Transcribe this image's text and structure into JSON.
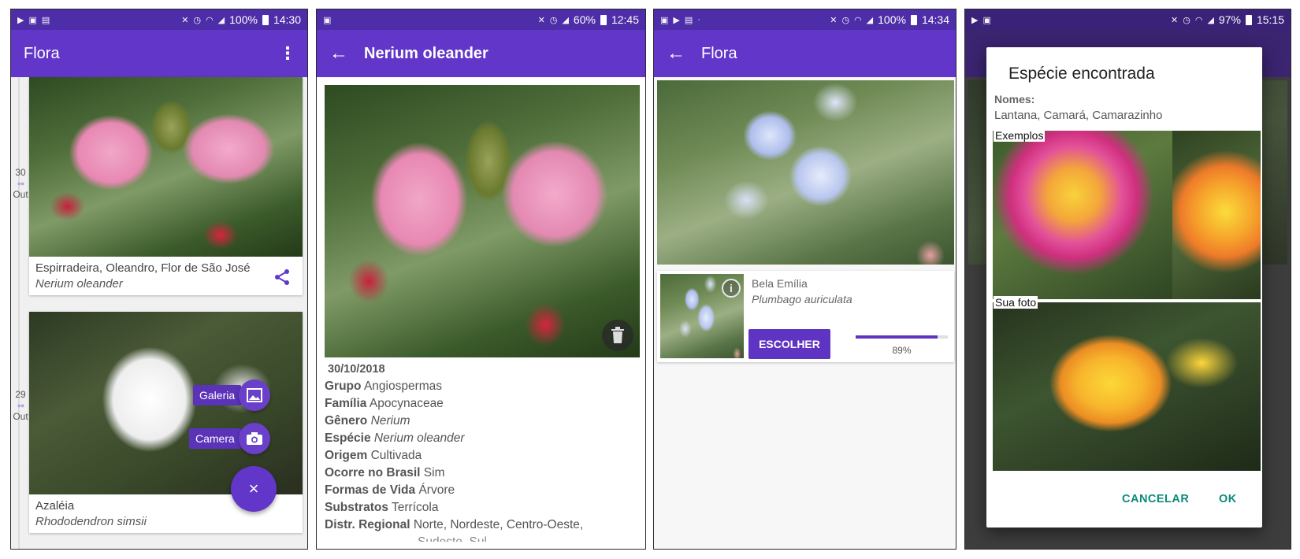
{
  "screens": [
    {
      "status": {
        "battery": "100%",
        "time": "14:30"
      },
      "appbar": {
        "title": "Flora"
      },
      "timeline": [
        {
          "day": "30",
          "month": "Out"
        },
        {
          "day": "29",
          "month": "Out"
        }
      ],
      "cards": [
        {
          "common": "Espirradeira, Oleandro, Flor de São José",
          "scientific": "Nerium oleander"
        },
        {
          "common": "Azaléia",
          "scientific": "Rhododendron simsii"
        }
      ],
      "fab_menu": {
        "gallery_label": "Galeria",
        "camera_label": "Camera",
        "close_label": "×"
      }
    },
    {
      "status": {
        "battery": "60%",
        "time": "12:45"
      },
      "appbar": {
        "title": "Nerium oleander"
      },
      "date": "30/10/2018",
      "details": [
        {
          "label": "Grupo",
          "value": "Angiospermas",
          "italic": false
        },
        {
          "label": "Família",
          "value": "Apocynaceae",
          "italic": false
        },
        {
          "label": "Gênero",
          "value": "Nerium",
          "italic": true
        },
        {
          "label": "Espécie",
          "value": "Nerium oleander",
          "italic": true
        },
        {
          "label": "Origem",
          "value": "Cultivada",
          "italic": false
        },
        {
          "label": "Ocorre no Brasil",
          "value": "Sim",
          "italic": false
        },
        {
          "label": "Formas de Vida",
          "value": "Árvore",
          "italic": false
        },
        {
          "label": "Substratos",
          "value": "Terrícola",
          "italic": false
        },
        {
          "label": "Distr. Regional",
          "value": "Norte, Nordeste, Centro-Oeste,",
          "italic": false
        }
      ],
      "details_cut_line": "Sudeste, Sul"
    },
    {
      "status": {
        "battery": "100%",
        "time": "14:34"
      },
      "appbar": {
        "title": "Flora"
      },
      "result": {
        "common": "Bela Emília",
        "scientific": "Plumbago auriculata",
        "choose_label": "ESCOLHER",
        "confidence_label": "89%",
        "confidence": 0.89
      }
    },
    {
      "status": {
        "battery": "97%",
        "time": "15:15"
      },
      "dialog": {
        "title": "Espécie encontrada",
        "names_label": "Nomes:",
        "names": "Lantana, Camará, Camarazinho",
        "examples_label": "Exemplos",
        "photo_label": "Sua foto",
        "cancel_label": "CANCELAR",
        "ok_label": "OK"
      }
    }
  ],
  "colors": {
    "primary": "#6236c8",
    "status_bar": "#4e2ea8",
    "accent_teal": "#0d8a7a"
  }
}
